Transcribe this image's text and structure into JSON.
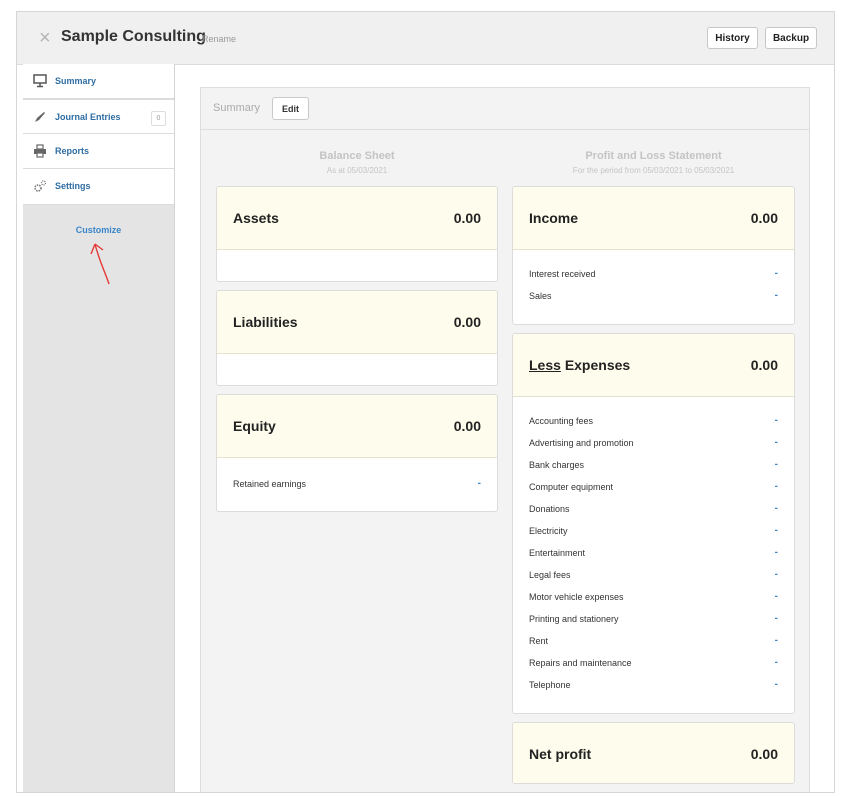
{
  "header": {
    "company": "Sample Consulting",
    "rename": "Rename",
    "history": "History",
    "backup": "Backup"
  },
  "sidebar": {
    "items": [
      {
        "label": "Summary",
        "icon": "monitor-icon"
      },
      {
        "label": "Journal Entries",
        "icon": "pen-icon",
        "badge": "0"
      },
      {
        "label": "Reports",
        "icon": "printer-icon"
      },
      {
        "label": "Settings",
        "icon": "gear-icon"
      }
    ],
    "customize": "Customize"
  },
  "main": {
    "title": "Summary",
    "edit": "Edit",
    "balance": {
      "title": "Balance Sheet",
      "subtitle": "As at 05/03/2021",
      "assets": {
        "label": "Assets",
        "value": "0.00"
      },
      "liabilities": {
        "label": "Liabilities",
        "value": "0.00"
      },
      "equity": {
        "label": "Equity",
        "value": "0.00",
        "rows": [
          {
            "label": "Retained earnings",
            "value": "-"
          }
        ]
      }
    },
    "pl": {
      "title": "Profit and Loss Statement",
      "subtitle": "For the period from 05/03/2021 to 05/03/2021",
      "income": {
        "label": "Income",
        "value": "0.00",
        "rows": [
          {
            "label": "Interest received",
            "value": "-"
          },
          {
            "label": "Sales",
            "value": "-"
          }
        ]
      },
      "expenses": {
        "label_prefix": "Less",
        "label": "Expenses",
        "value": "0.00",
        "rows": [
          {
            "label": "Accounting fees",
            "value": "-"
          },
          {
            "label": "Advertising and promotion",
            "value": "-"
          },
          {
            "label": "Bank charges",
            "value": "-"
          },
          {
            "label": "Computer equipment",
            "value": "-"
          },
          {
            "label": "Donations",
            "value": "-"
          },
          {
            "label": "Electricity",
            "value": "-"
          },
          {
            "label": "Entertainment",
            "value": "-"
          },
          {
            "label": "Legal fees",
            "value": "-"
          },
          {
            "label": "Motor vehicle expenses",
            "value": "-"
          },
          {
            "label": "Printing and stationery",
            "value": "-"
          },
          {
            "label": "Rent",
            "value": "-"
          },
          {
            "label": "Repairs and maintenance",
            "value": "-"
          },
          {
            "label": "Telephone",
            "value": "-"
          }
        ]
      },
      "net": {
        "label": "Net profit",
        "value": "0.00"
      }
    }
  }
}
